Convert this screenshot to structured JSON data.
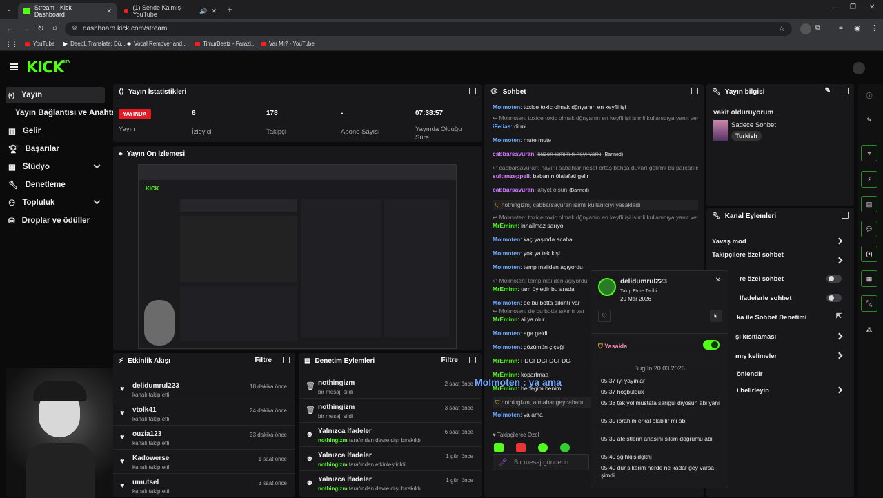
{
  "browser": {
    "tabs": [
      {
        "label": "Stream - Kick Dashboard",
        "active": true
      },
      {
        "label": "(1) Sende Kalmış - YouTube",
        "active": false
      }
    ],
    "url": "dashboard.kick.com/stream",
    "bookmarks": [
      "YouTube",
      "DeepL Translate: Dü...",
      "Vocal Remover and...",
      "TimurBeatz - Farazi...",
      "Var Mı? - YouTube"
    ]
  },
  "brand": {
    "logo": "KICK",
    "beta": "BETA",
    "accent": "#53fc18"
  },
  "sidebar": {
    "items": [
      {
        "label": "Yayın",
        "icon": "broadcast-icon",
        "active": true
      },
      {
        "label": "Yayın Bağlantısı ve Anahtarı",
        "icon": "",
        "sub": true
      },
      {
        "label": "Gelir",
        "icon": "chart-icon"
      },
      {
        "label": "Başarılar",
        "icon": "trophy-icon"
      },
      {
        "label": "Stüdyo",
        "icon": "studio-icon",
        "expand": true
      },
      {
        "label": "Denetleme",
        "icon": "wrench-icon"
      },
      {
        "label": "Topluluk",
        "icon": "community-icon",
        "expand": true
      },
      {
        "label": "Droplar ve ödüller",
        "icon": "gift-icon"
      }
    ]
  },
  "stats": {
    "title": "Yayın İstatistikleri",
    "live_badge": "YAYINDA",
    "live_label": "Yayın",
    "items": [
      {
        "value": "6",
        "label": "İzleyici"
      },
      {
        "value": "178",
        "label": "Takipçi"
      },
      {
        "value": "-",
        "label": "Abone Sayısı"
      },
      {
        "value": "07:38:57",
        "label": "Yayında Olduğu Süre"
      }
    ]
  },
  "preview": {
    "title": "Yayın Ön İzlemesi"
  },
  "activity": {
    "title": "Etkinlik Akışı",
    "filter": "Filtre",
    "items": [
      {
        "name": "delidumrul223",
        "sub": "kanalı takip etti",
        "time": "18 dakika önce"
      },
      {
        "name": "vtolk41",
        "sub": "kanalı takip etti",
        "time": "24 dakika önce"
      },
      {
        "name": "ouzia123",
        "sub": "kanalı takip etti",
        "time": "33 dakika önce"
      },
      {
        "name": "Kadowerse",
        "sub": "kanalı takip etti",
        "time": "1 saat önce"
      },
      {
        "name": "umutsel",
        "sub": "kanalı takip etti",
        "time": "3 saat önce"
      }
    ]
  },
  "modactions": {
    "title": "Denetim Eylemleri",
    "filter": "Filtre",
    "items": [
      {
        "name": "nothingizm",
        "sub": "bir mesajı sildi",
        "time": "2 saat önce",
        "actor": ""
      },
      {
        "name": "nothingizm",
        "sub": "bir mesajı sildi",
        "time": "3 saat önce",
        "actor": ""
      },
      {
        "name": "Yalnızca İfadeler",
        "actor": "nothingizm",
        "sub": "tarafından devre dışı bırakıldı",
        "time": "6 saat önce"
      },
      {
        "name": "Yalnızca İfadeler",
        "actor": "nothingizm",
        "sub": "tarafından etkinleştirildi",
        "time": "1 gün önce"
      },
      {
        "name": "Yalnızca İfadeler",
        "actor": "nothingizm",
        "sub": "tarafından devre dışı bırakıldı",
        "time": "1 gün önce"
      }
    ]
  },
  "chat": {
    "title": "Sohbet",
    "input_placeholder": "Bir mesaj gönderin",
    "followers_label": "Takipçilerce Özel",
    "overlay": "Molmoten : ya ama",
    "lines": [
      {
        "user": "Molmoten",
        "color": "#6ea8ff",
        "text": "toxice toxic olmak dğnyanın en keyfli işi"
      },
      {
        "sys": "Molmoten: toxice toxic olmak dğnyanın en keyfli işi isimli kullanıcıya yanıt ver..."
      },
      {
        "user": "iFelias",
        "color": "#6ea8ff",
        "text": "di mi"
      },
      {
        "user": "Molmoten",
        "color": "#6ea8ff",
        "text": "mute mute"
      },
      {
        "user": "cabbarsavuran",
        "color": "#d77cff",
        "text": "kuzen ismimin neyi varki",
        "banned": "(Banned)"
      },
      {
        "sys": "cabbarsavuran: hayırlı sabahlar neşet ertaş bahça duvarı gelirmi bu parçanın ..."
      },
      {
        "user": "sultanzeppeli",
        "color": "#d77cff",
        "text": "babanın ölalafati gelir"
      },
      {
        "user": "cabbarsavuran",
        "color": "#d77cff",
        "text": "afiyet olsun",
        "banned": "(Banned)"
      },
      {
        "mod": "nothingizm, cabbarsavuran isimli kullanıcıyı yasakladı"
      },
      {
        "sys": "Molmoten: toxice toxic olmak dğnyanın en keyfli işi isimli kullanıcıya yanıt ver..."
      },
      {
        "user": "MrEminn",
        "color": "#53fc18",
        "text": "innailmaz sarıyo"
      },
      {
        "user": "Molmoten",
        "color": "#6ea8ff",
        "text": "kaç yaşında acaba"
      },
      {
        "user": "Molmoten",
        "color": "#6ea8ff",
        "text": "yok ya tek kişi"
      },
      {
        "user": "Molmoten",
        "color": "#6ea8ff",
        "text": "temp mailden açıyordu"
      },
      {
        "sys": "Molmoten: temp mailden açıyordu"
      },
      {
        "user": "MrEminn",
        "color": "#53fc18",
        "text": "tam öyledir bu arada"
      },
      {
        "user": "Molmoten",
        "color": "#6ea8ff",
        "text": "de bu botta sıkıntı var"
      },
      {
        "sys": "Molmoten: de bu botta sıkıntı var"
      },
      {
        "user": "MrEminn",
        "color": "#53fc18",
        "text": "ai ya olur"
      },
      {
        "user": "Molmoten",
        "color": "#6ea8ff",
        "text": "aga geldi"
      },
      {
        "user": "Molmoten",
        "color": "#6ea8ff",
        "text": "gözümün çiçeği"
      },
      {
        "user": "MrEminn",
        "color": "#53fc18",
        "text": "FDGFDGFDGFDG"
      },
      {
        "user": "MrEminn",
        "color": "#53fc18",
        "text": "kopartmaa"
      },
      {
        "user": "MrEminn",
        "color": "#53fc18",
        "text": "bebegim benim"
      },
      {
        "mod": "nothingizm, atmabangeybabanı"
      },
      {
        "user": "Molmoten",
        "color": "#6ea8ff",
        "text": "ya ama"
      }
    ]
  },
  "info": {
    "title": "Yayın bilgisi",
    "stream_title": "vakit öldürüyorum",
    "category": "Sadece Sohbet",
    "tag": "Turkish"
  },
  "channel_actions": {
    "title": "Kanal Eylemleri",
    "items": [
      {
        "label": "Yavaş mod",
        "ctl": "arrow"
      },
      {
        "label": "Takipçilere özel sohbet",
        "ctl": "arrow"
      },
      {
        "label": "re özel sohbet",
        "ctl": "toggle"
      },
      {
        "label": "İfadelerle sohbet",
        "ctl": "toggle"
      },
      {
        "label": "ka ile Sohbet Denetimi",
        "ctl": "link"
      },
      {
        "label": "şı kısıtlaması",
        "ctl": "arrow"
      },
      {
        "label": "mış kelimeler",
        "ctl": "arrow"
      },
      {
        "label": "önlendir",
        "ctl": "none"
      },
      {
        "label": "i belirleyin",
        "ctl": "arrow"
      }
    ]
  },
  "usercard": {
    "name": "delidumrul223",
    "follow_label": "Takip Etme Tarihi",
    "follow_date": "20 Mar 2026",
    "ban_label": "Yasakla",
    "ban_on": true,
    "day": "Bugün 20.03.2026",
    "messages": [
      {
        "time": "05:37",
        "text": "iyi yayınlar"
      },
      {
        "time": "05:37",
        "text": "hoşbulduk"
      },
      {
        "time": "05:38",
        "text": "tek yol mustafa sarıgül diyosun abi yani"
      },
      {
        "time": "05:39",
        "text": "ibrahim erkal olabilir mi abi"
      },
      {
        "time": "05:39",
        "text": "ateistlerin anasını sikim doğrumu abi"
      },
      {
        "time": "05:40",
        "text": "şglhkjlşldgkhj"
      },
      {
        "time": "05:40",
        "text": "dur sikerim nerde ne kadar gey varsa şimdi"
      }
    ]
  }
}
